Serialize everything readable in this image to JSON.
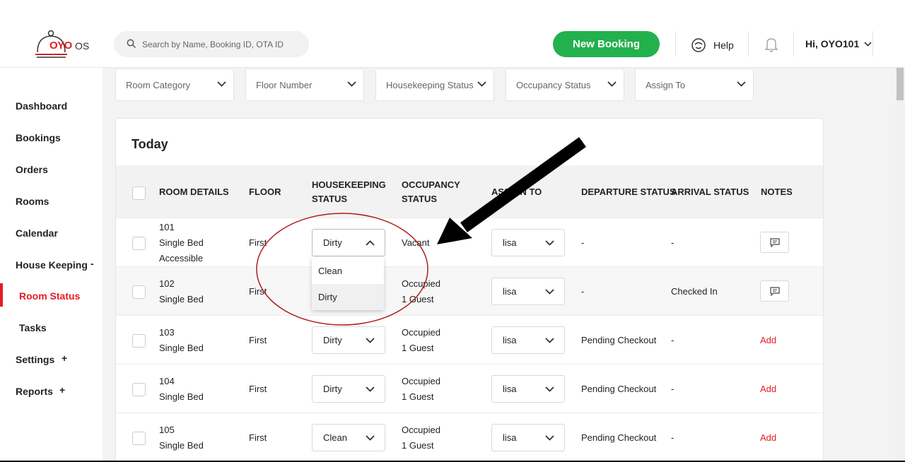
{
  "brand": {
    "logo": "OYO",
    "suffix": "OS",
    "accent": "#e31d23",
    "green": "#23b14d"
  },
  "header": {
    "search_placeholder": "Search by Name, Booking ID, OTA ID",
    "new_booking": "New Booking",
    "help": "Help",
    "user": "Hi, OYO101"
  },
  "sidebar": {
    "items": [
      {
        "label": "Dashboard"
      },
      {
        "label": "Bookings"
      },
      {
        "label": "Orders"
      },
      {
        "label": "Rooms"
      },
      {
        "label": "Calendar"
      },
      {
        "label": "House Keeping",
        "sign": "-"
      },
      {
        "label": "Room Status",
        "active": true
      },
      {
        "label": "Tasks"
      },
      {
        "label": "Settings",
        "sign": "+"
      },
      {
        "label": "Reports",
        "sign": "+"
      }
    ]
  },
  "filters": [
    "Room Category",
    "Floor Number",
    "Housekeeping Status",
    "Occupancy Status",
    "Assign To"
  ],
  "table": {
    "title": "Today",
    "headers": {
      "room": "ROOM DETAILS",
      "floor": "FLOOR",
      "hk1": "HOUSEKEEPING",
      "hk2": "STATUS",
      "occ1": "OCCUPANCY",
      "occ2": "STATUS",
      "assign": "ASSIGN TO",
      "departure": "DEPARTURE STATUS",
      "arrival": "ARRIVAL STATUS",
      "notes": "NOTES"
    },
    "rows": [
      {
        "room": "101",
        "type": "Single Bed",
        "extra": "Accessible",
        "floor": "First",
        "hk": "Dirty",
        "occ1": "Vacant",
        "occ2": "",
        "assign": "lisa",
        "departure": "-",
        "arrival": "-",
        "notes": ""
      },
      {
        "room": "102",
        "type": "Single Bed",
        "extra": "",
        "floor": "First",
        "hk": "Dirty",
        "occ1": "Occupied",
        "occ2": "1 Guest",
        "assign": "lisa",
        "departure": "-",
        "arrival": "Checked In",
        "notes": ""
      },
      {
        "room": "103",
        "type": "Single Bed",
        "extra": "",
        "floor": "First",
        "hk": "Dirty",
        "occ1": "Occupied",
        "occ2": "1 Guest",
        "assign": "lisa",
        "departure": "Pending Checkout",
        "arrival": "-",
        "notes": "Add"
      },
      {
        "room": "104",
        "type": "Single Bed",
        "extra": "",
        "floor": "First",
        "hk": "Dirty",
        "occ1": "Occupied",
        "occ2": "1 Guest",
        "assign": "lisa",
        "departure": "Pending Checkout",
        "arrival": "-",
        "notes": "Add"
      },
      {
        "room": "105",
        "type": "Single Bed",
        "extra": "",
        "floor": "First",
        "hk": "Clean",
        "occ1": "Occupied",
        "occ2": "1 Guest",
        "assign": "lisa",
        "departure": "Pending Checkout",
        "arrival": "-",
        "notes": "Add"
      }
    ]
  },
  "hk_dropdown": {
    "options": [
      "Clean",
      "Dirty"
    ],
    "selected": "Dirty"
  }
}
